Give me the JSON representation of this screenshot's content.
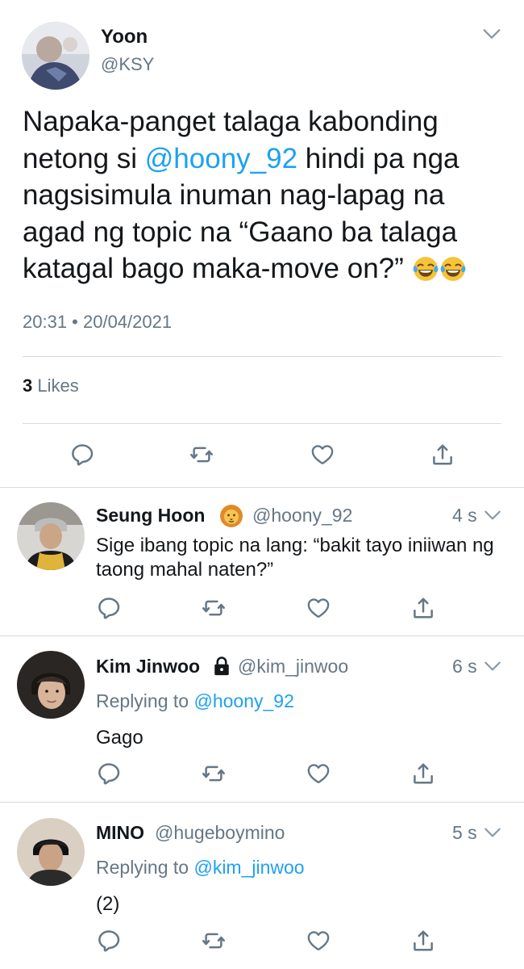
{
  "main_tweet": {
    "name": "Yoon",
    "handle": "@KSY",
    "text_parts": {
      "before": "Napaka-panget talaga kabonding netong si ",
      "mention": "@hoony_92",
      "after": " hindi pa nga nagsisimula inuman nag-lapag na agad ng topic na “Gaano ba talaga katagal bago maka-move on?” "
    },
    "emoji": [
      "face-with-tears-of-joy",
      "face-with-tears-of-joy"
    ],
    "timestamp": "20:31 • 20/04/2021",
    "likes_count": "3",
    "likes_label": "Likes"
  },
  "replies": [
    {
      "name": "Seung Hoon",
      "badge": "lion-emoji",
      "handle": "@hoony_92",
      "time": "4 s",
      "text": "Sige ibang topic na lang: “bakit tayo iniiwan ng taong mahal naten?”"
    },
    {
      "name": "Kim Jinwoo",
      "badge": "lock-icon",
      "handle": "@kim_jinwoo",
      "time": "6 s",
      "replying_label": "Replying to",
      "replying_to": "@hoony_92",
      "text": "Gago"
    },
    {
      "name": "MINO",
      "handle": "@hugeboymino",
      "time": "5 s",
      "replying_label": "Replying to",
      "replying_to": "@kim_jinwoo",
      "text": "(2)"
    }
  ],
  "colors": {
    "accent": "#1da1f2",
    "secondary_text": "#657786",
    "primary_text": "#14171a",
    "divider": "#d6dbe0"
  }
}
